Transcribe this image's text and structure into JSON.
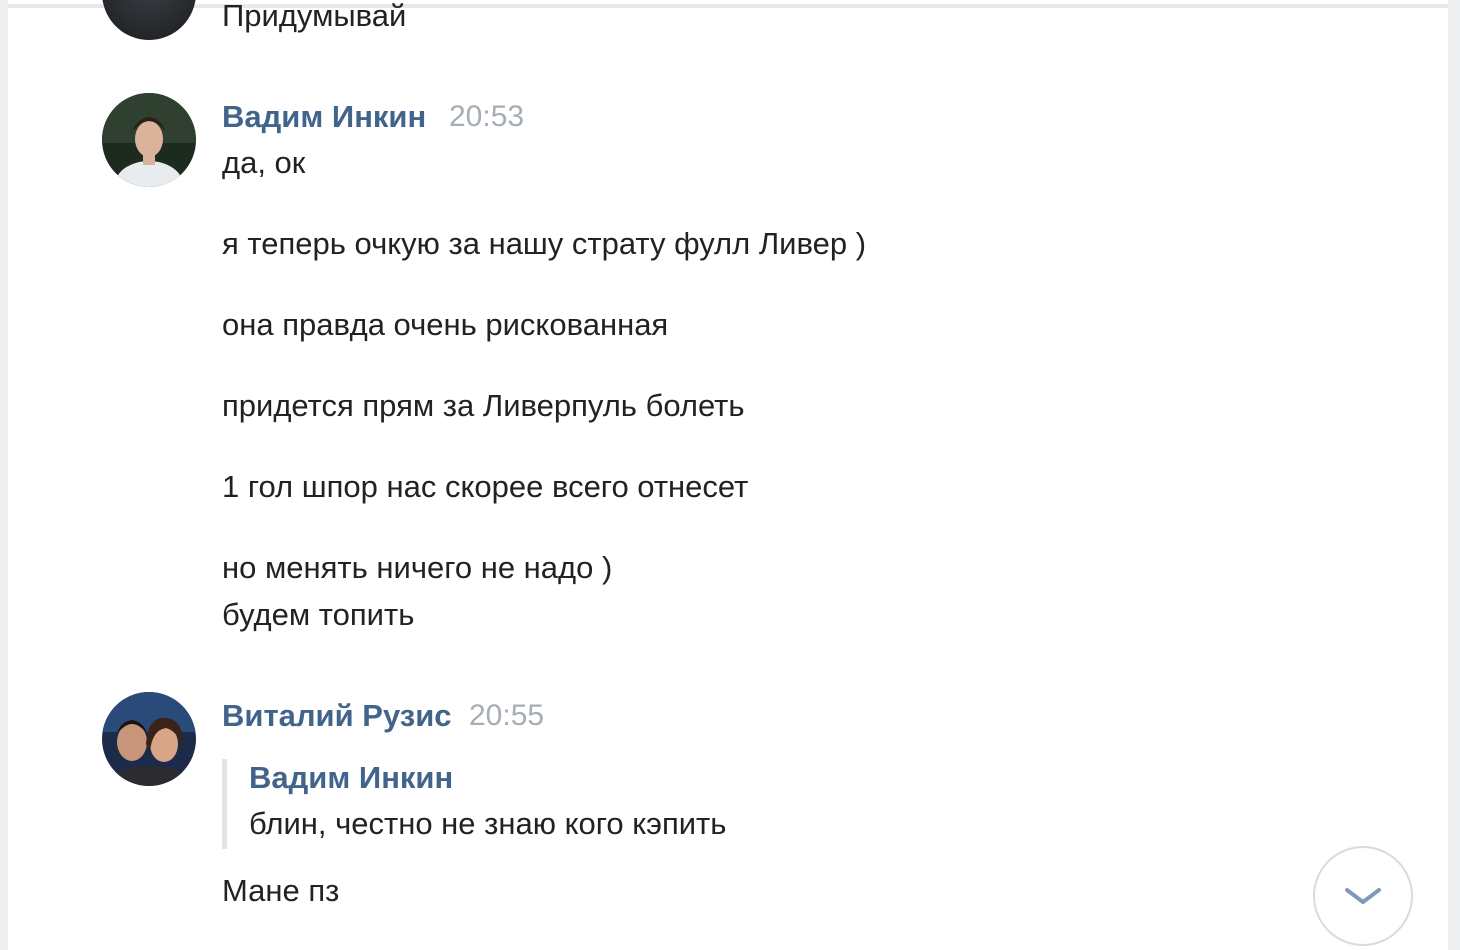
{
  "chat": {
    "partial_message": {
      "text": "Придумывай"
    },
    "messages": [
      {
        "author": "Вадим Инкин",
        "time": "20:53",
        "lines": [
          "да, ок",
          "я теперь очкую за нашу страту фулл Ливер )",
          "она правда очень рискованная",
          "придется прям за Ливерпуль болеть",
          "1 гол шпор нас скорее всего отнесет",
          "но менять ничего не надо )",
          "будем топить"
        ]
      },
      {
        "author": "Виталий Рузис",
        "time": "20:55",
        "quote": {
          "author": "Вадим Инкин",
          "text": "блин, честно не знаю кого кэпить"
        },
        "lines": [
          "Мане пз"
        ]
      }
    ]
  },
  "scroll_button": {
    "icon": "chevron-down-icon"
  },
  "colors": {
    "author_link": "#42648b",
    "timestamp": "#a6adb6",
    "text": "#222222",
    "background": "#edeef0"
  }
}
